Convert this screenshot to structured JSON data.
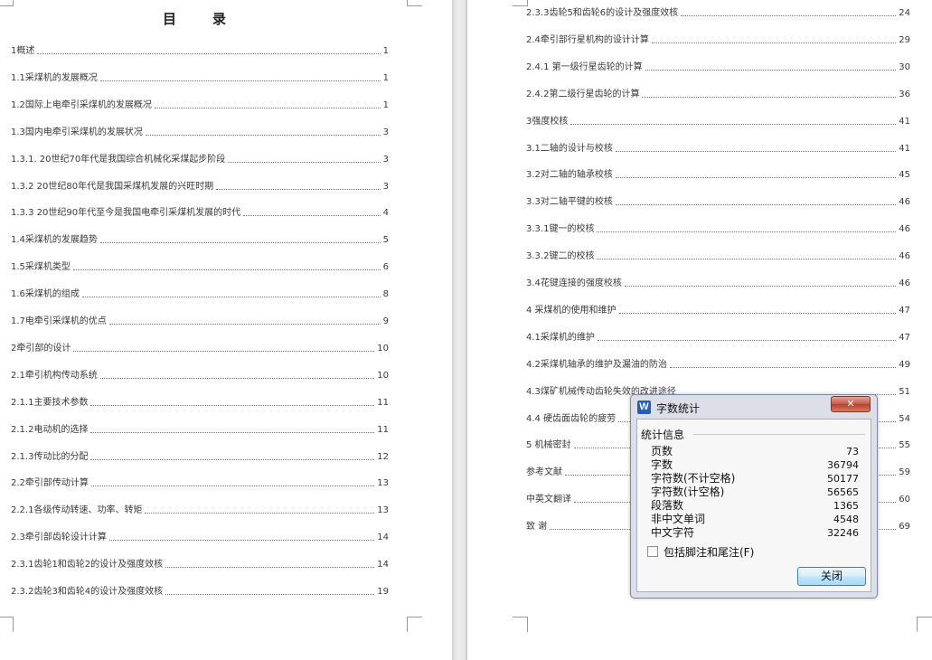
{
  "document": {
    "left_page": {
      "title": "目录",
      "entries": [
        {
          "text": "1概述",
          "page": "1"
        },
        {
          "text": "1.1采煤机的发展概况",
          "page": "1"
        },
        {
          "text": "1.2国际上电牵引采煤机的发展概况",
          "page": "1"
        },
        {
          "text": "1.3国内电牵引采煤机的发展状况",
          "page": "3"
        },
        {
          "text": "1.3.1. 20世纪70年代是我国综合机械化采煤起步阶段",
          "page": "3"
        },
        {
          "text": "1.3.2  20世纪80年代是我国采煤机发展的兴旺时期",
          "page": "3"
        },
        {
          "text": "1.3.3  20世纪90年代至今是我国电牵引采煤机发展的时代",
          "page": "4"
        },
        {
          "text": "1.4采煤机的发展趋势",
          "page": "5"
        },
        {
          "text": "1.5采煤机类型",
          "page": "6"
        },
        {
          "text": "1.6采煤机的组成",
          "page": "8"
        },
        {
          "text": "1.7电牵引采煤机的优点",
          "page": "9"
        },
        {
          "text": "2牵引部的设计",
          "page": "10"
        },
        {
          "text": "2.1牵引机构传动系统",
          "page": "10"
        },
        {
          "text": "2.1.1主要技术参数",
          "page": "11"
        },
        {
          "text": "2.1.2电动机的选择",
          "page": "11"
        },
        {
          "text": "2.1.3传动比的分配",
          "page": "12"
        },
        {
          "text": "2.2牵引部传动计算",
          "page": "13"
        },
        {
          "text": "2.2.1各级传动转速、功率、转矩",
          "page": "13"
        },
        {
          "text": "2.3牵引部齿轮设计计算",
          "page": "14"
        },
        {
          "text": "2.3.1齿轮1和齿轮2的设计及强度效核",
          "page": "14"
        },
        {
          "text": "2.3.2齿轮3和齿轮4的设计及强度效核",
          "page": "19"
        }
      ]
    },
    "right_page": {
      "entries": [
        {
          "text": "2.3.3齿轮5和齿轮6的设计及强度效核",
          "page": "24"
        },
        {
          "text": "2.4牵引部行星机构的设计计算",
          "page": "29"
        },
        {
          "text": "2.4.1 第一级行星齿轮的计算",
          "page": "30"
        },
        {
          "text": "2.4.2第二级行星齿轮的计算",
          "page": "36"
        },
        {
          "text": "3强度校核",
          "page": "41"
        },
        {
          "text": "3.1二轴的设计与校核",
          "page": "41"
        },
        {
          "text": "3.2对二轴的轴承校核",
          "page": "45"
        },
        {
          "text": "3.3对二轴平键的校核",
          "page": "46"
        },
        {
          "text": "3.3.1键一的校核",
          "page": "46"
        },
        {
          "text": "3.3.2键二的校核",
          "page": "46"
        },
        {
          "text": "3.4花键连接的强度校核",
          "page": "46"
        },
        {
          "text": "4 采煤机的使用和维护",
          "page": "47"
        },
        {
          "text": "4.1采煤机的维护",
          "page": "47"
        },
        {
          "text": "4.2采煤机轴承的维护及漏油的防治",
          "page": "49"
        },
        {
          "text": "4.3煤矿机械传动齿轮失效的改进途径",
          "page": "51"
        },
        {
          "text": "4.4 硬齿面齿轮的疲劳",
          "page": "54"
        },
        {
          "text": "5 机械密封",
          "page": "55"
        },
        {
          "text": "参考文献",
          "page": "59"
        },
        {
          "text": "中英文翻译",
          "page": "60"
        },
        {
          "text": "致  谢",
          "page": "69"
        }
      ]
    }
  },
  "dialog": {
    "title": "字数统计",
    "app_icon": "W",
    "close_glyph": "✕",
    "group_label": "统计信息",
    "stats": [
      {
        "label": "页数",
        "value": "73"
      },
      {
        "label": "字数",
        "value": "36794"
      },
      {
        "label": "字符数(不计空格)",
        "value": "50177"
      },
      {
        "label": "字符数(计空格)",
        "value": "56565"
      },
      {
        "label": "段落数",
        "value": "1365"
      },
      {
        "label": "非中文单词",
        "value": "4548"
      },
      {
        "label": "中文字符",
        "value": "32246"
      }
    ],
    "checkbox_label": "包括脚注和尾注(F)",
    "checkbox_checked": false,
    "close_button_label": "关闭"
  }
}
